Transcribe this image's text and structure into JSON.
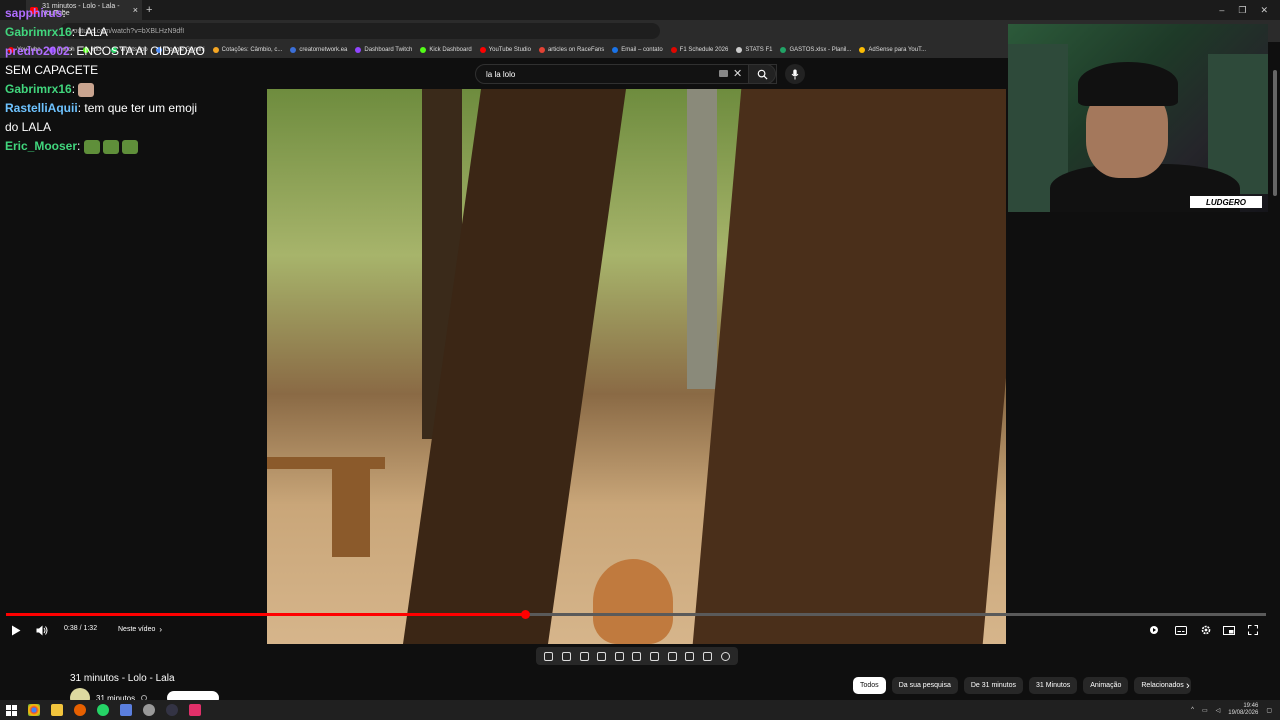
{
  "browser": {
    "tab_title": "31 minutos - Lolo - Lala - YouTube",
    "url": "youtube.com/watch?v=bXBLHzN9dfI",
    "bookmarks": [
      {
        "label": "YouTube",
        "color": "#ff0000"
      },
      {
        "label": "Twitch",
        "color": "#9146ff"
      },
      {
        "label": "Kick",
        "color": "#53fc18"
      },
      {
        "label": "WhatsApp",
        "color": "#25d366"
      },
      {
        "label": "Google Gemini",
        "color": "#4f8ef7"
      },
      {
        "label": "Cotações: Câmbio, c...",
        "color": "#f5a623"
      },
      {
        "label": "creatornetwork.ea",
        "color": "#3b6fd8"
      },
      {
        "label": "Dashboard Twitch",
        "color": "#9146ff"
      },
      {
        "label": "Kick Dashboard",
        "color": "#53fc18"
      },
      {
        "label": "YouTube Studio",
        "color": "#ff0000"
      },
      {
        "label": "articles on RaceFans",
        "color": "#e34234"
      },
      {
        "label": "Email – contato",
        "color": "#1a73e8"
      },
      {
        "label": "F1 Schedule 2026",
        "color": "#e10600"
      },
      {
        "label": "STATS F1",
        "color": "#cccccc"
      },
      {
        "label": "GASTOS.xlsx - Planil...",
        "color": "#21a366"
      },
      {
        "label": "AdSense para YouT...",
        "color": "#fbbc04"
      }
    ]
  },
  "search": {
    "query": "la la lolo"
  },
  "chat": [
    {
      "user": "sapphirus",
      "color": "#b06dff",
      "text": "",
      "emotes": 0
    },
    {
      "user": "Gabrimrx16",
      "color": "#41d67d",
      "text": "LALA",
      "emotes": 0
    },
    {
      "user": "predro2002",
      "color": "#b06dff",
      "text": "ENCOSTA AI CIDADAO SEM CAPACETE",
      "emotes": 0
    },
    {
      "user": "Gabrimrx16",
      "color": "#41d67d",
      "text": "",
      "emotes": 1
    },
    {
      "user": "RastelliAquii",
      "color": "#6ec3ff",
      "text": "tem que ter um emoji do LALA",
      "emotes": 0
    },
    {
      "user": "Eric_Mooser",
      "color": "#41d67d",
      "text": "",
      "emotes": 3
    }
  ],
  "webcam": {
    "logo_text": "LUDGERO"
  },
  "player": {
    "progress_fraction": 0.412,
    "time": "0:38 / 1:32",
    "next_label": "Neste vídeo"
  },
  "video": {
    "title": "31 minutos - Lolo - Lala",
    "channel": "31 minutos"
  },
  "chips": [
    "Todos",
    "Da sua pesquisa",
    "De 31 minutos",
    "31 Minutos",
    "Animação",
    "Relacionados"
  ],
  "taskbar": {
    "time": "19:46",
    "date": "19/08/2026"
  }
}
